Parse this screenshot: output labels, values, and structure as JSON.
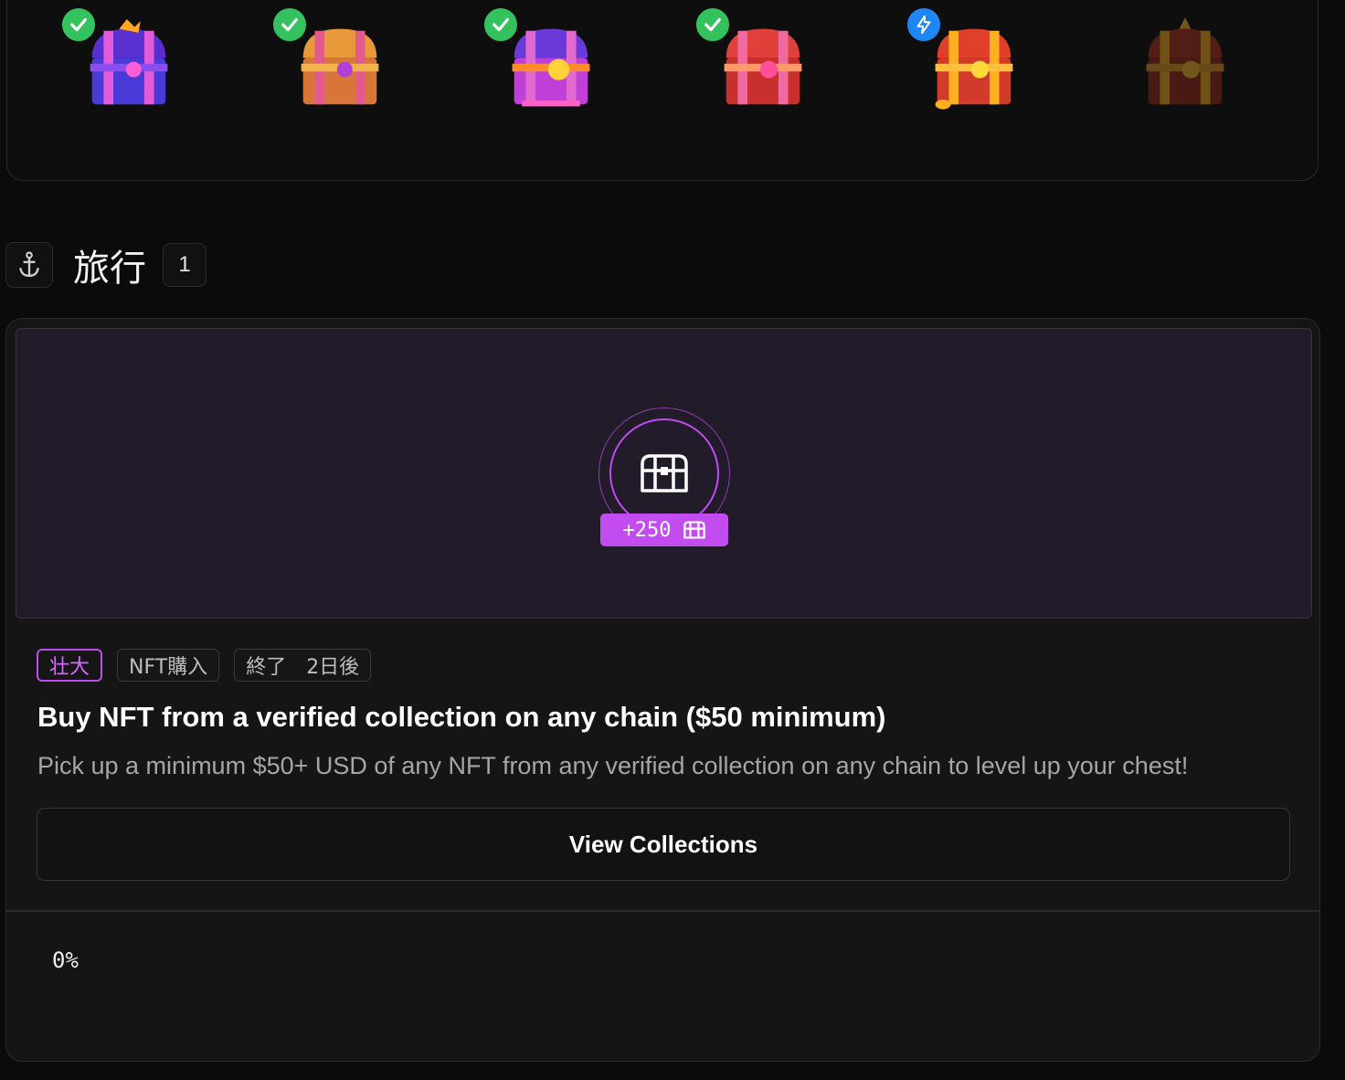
{
  "chest_track": {
    "chests": [
      {
        "name": "chest-1",
        "status": "completed",
        "badge_icon": "check-icon",
        "theme_color": "#7b3fe4"
      },
      {
        "name": "chest-2",
        "status": "completed",
        "badge_icon": "check-icon",
        "theme_color": "#e8a23a"
      },
      {
        "name": "chest-3",
        "status": "completed",
        "badge_icon": "check-icon",
        "theme_color": "#b03fe0"
      },
      {
        "name": "chest-4",
        "status": "completed",
        "badge_icon": "check-icon",
        "theme_color": "#e0403a"
      },
      {
        "name": "chest-5",
        "status": "current",
        "badge_icon": "bolt-icon",
        "theme_color": "#f0a020"
      },
      {
        "name": "chest-6",
        "status": "locked",
        "badge_icon": "",
        "theme_color": "#8a5a20"
      }
    ],
    "colors": {
      "completed_badge": "#34c25f",
      "current_badge": "#1f86f5"
    }
  },
  "section": {
    "icon": "anchor-icon",
    "title": "旅行",
    "count": "1"
  },
  "quest": {
    "reward_label": "+250",
    "reward_icon": "chest-icon",
    "tags": [
      "壮大",
      "NFT購入",
      "終了　2日後"
    ],
    "title": "Buy NFT from a verified collection on any chain ($50 minimum)",
    "description": "Pick up a minimum $50+ USD of any NFT from any verified collection on any chain to level up your chest!",
    "button_label": "View Collections",
    "progress": "0%",
    "progress_fraction": 0,
    "accent_color": "#c34cf1"
  }
}
